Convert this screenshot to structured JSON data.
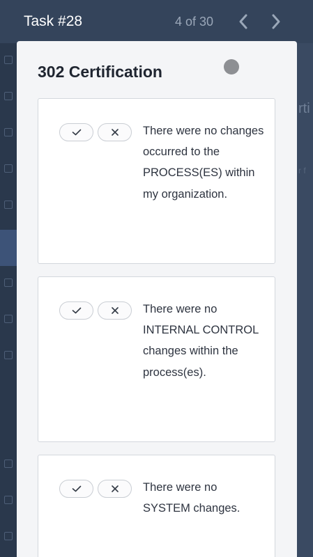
{
  "header": {
    "task_title": "Task #28",
    "pager": "4 of 30"
  },
  "modal": {
    "title": "302 Certification",
    "items": [
      {
        "text": "There were no changes occurred to the PROCESS(ES) within my organization."
      },
      {
        "text": "There were no INTERNAL CONTROL changes within the process(es)."
      },
      {
        "text": "There were no SYSTEM changes."
      }
    ]
  },
  "background": {
    "right_text": "rti",
    "right_small": "r f"
  },
  "colors": {
    "topbar_bg": "#34445b",
    "modal_bg": "#f4f5f7",
    "card_bg": "#ffffff",
    "text": "#1f2530"
  },
  "icons": {
    "prev": "chevron-left-icon",
    "next": "chevron-right-icon",
    "approve": "check-icon",
    "reject": "x-icon"
  }
}
